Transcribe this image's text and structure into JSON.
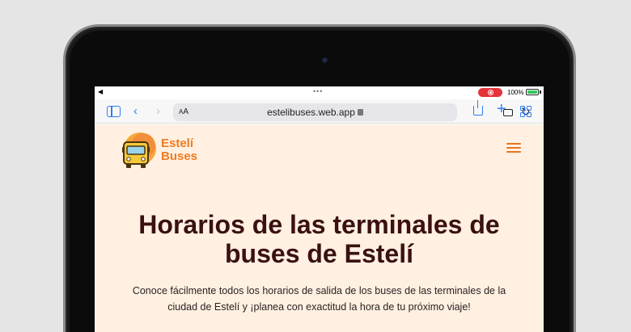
{
  "browser": {
    "url": "estelibuses.web.app",
    "text_size_label": "AA",
    "battery_percent": "100%"
  },
  "site": {
    "logo_line1": "Estelí",
    "logo_line2": "Buses",
    "title": "Horarios de las terminales de buses de Estelí",
    "description": "Conoce fácilmente todos los horarios de salida de los buses de las terminales de la ciudad de Estelí y ¡planea con exactitud la hora de tu próximo viaje!"
  },
  "colors": {
    "brand_orange": "#f07c21",
    "page_bg": "#fff0e1",
    "title_color": "#3a1010",
    "safari_accent": "#2f7cf6"
  },
  "icons": [
    "sidebar-icon",
    "back-icon",
    "forward-icon",
    "lock-icon",
    "extension-icon",
    "reload-icon",
    "share-icon",
    "plus-icon",
    "tabs-icon",
    "menu-icon",
    "bus-logo-icon"
  ]
}
